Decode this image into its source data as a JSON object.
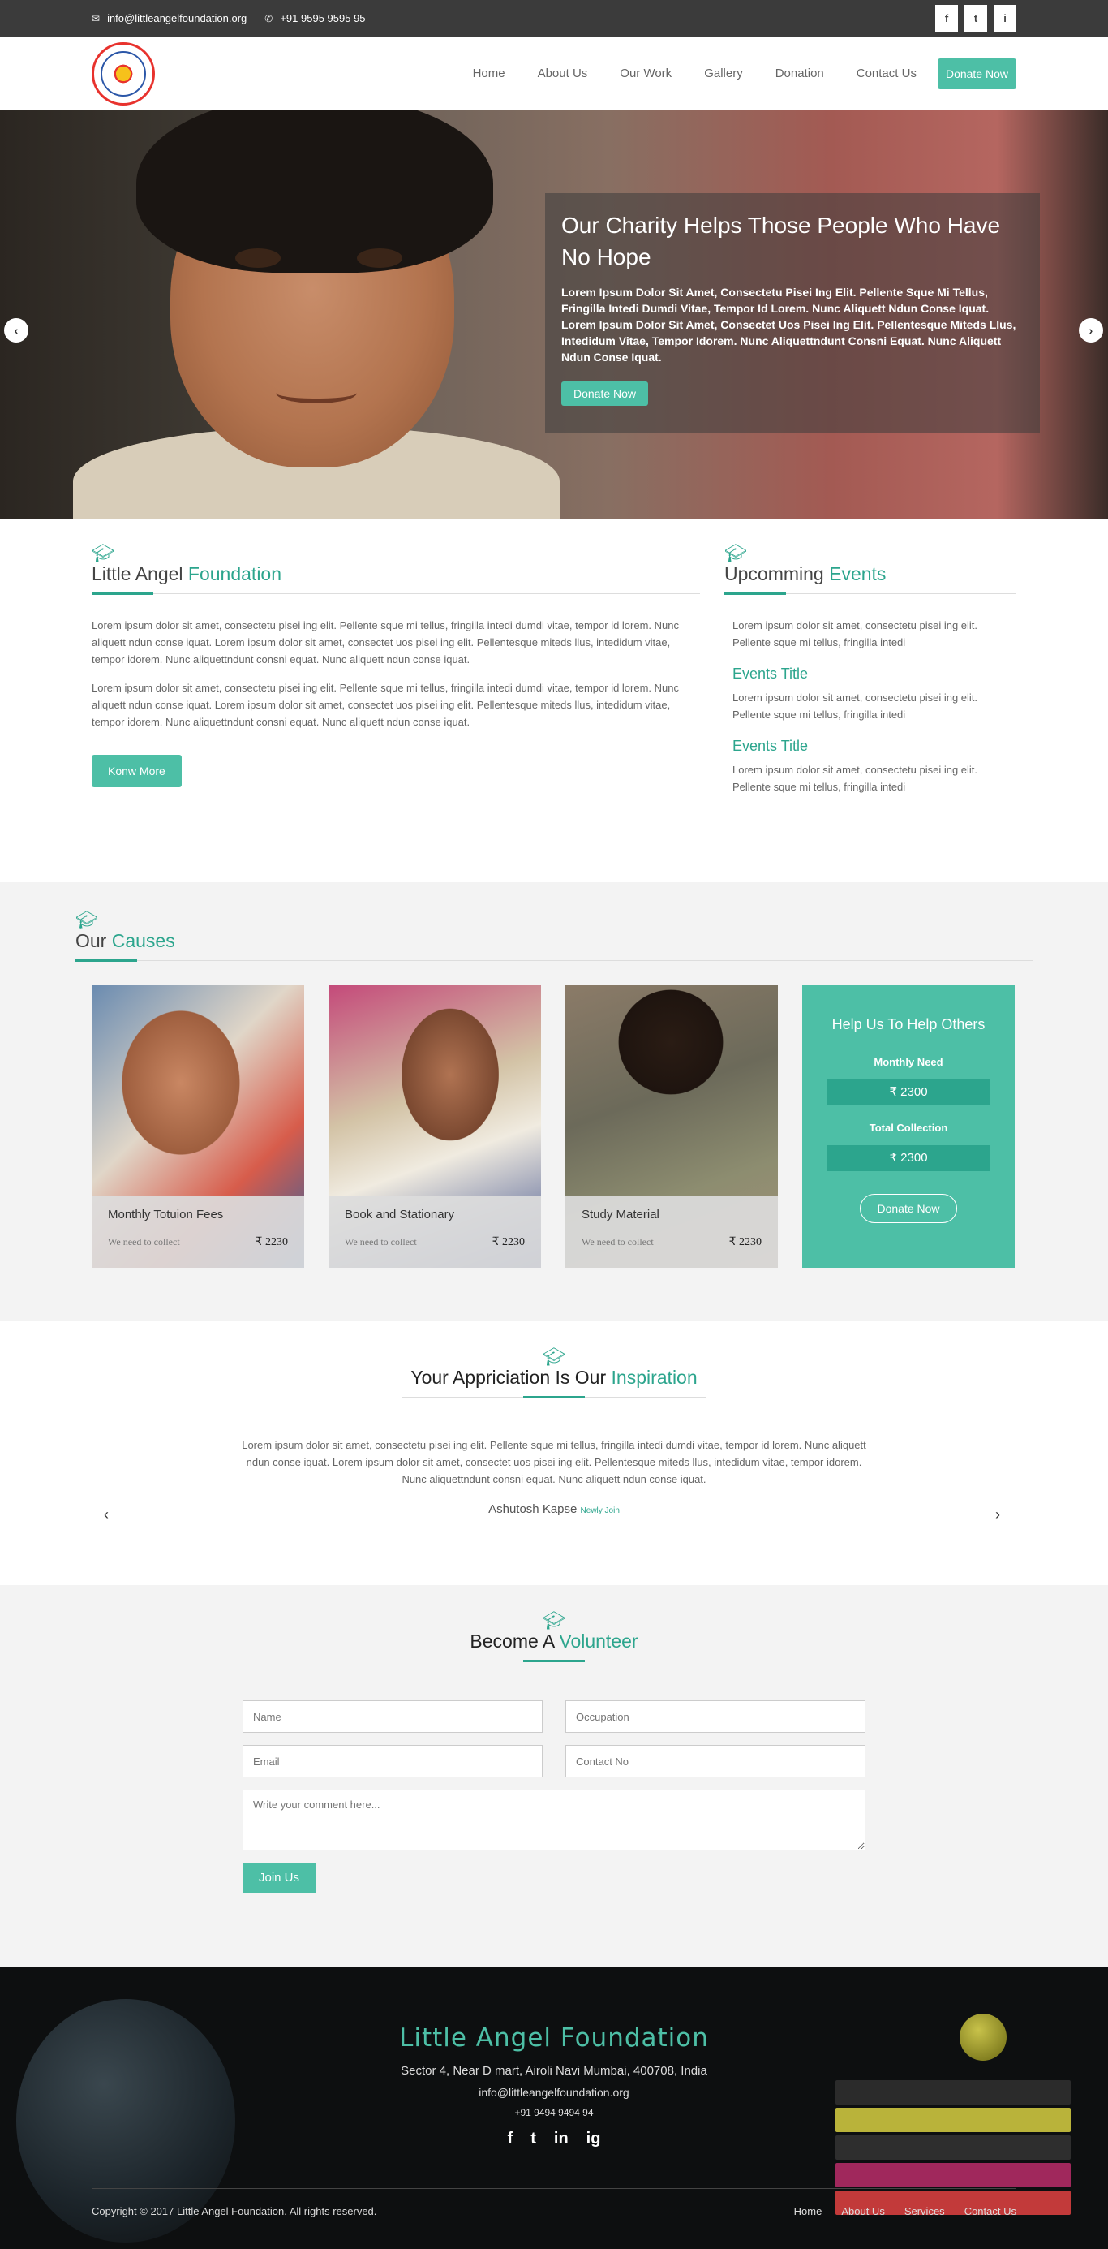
{
  "topbar": {
    "email": "info@littleangelfoundation.org",
    "phone": "+91 9595 9595 95",
    "email_icon": "envelope-icon",
    "phone_icon": "phone-icon",
    "socials": [
      "f",
      "t",
      "i"
    ]
  },
  "nav": {
    "logo": "Little Angel Foundation logo",
    "items": [
      "Home",
      "About Us",
      "Our Work",
      "Gallery",
      "Donation",
      "Contact Us"
    ],
    "cta": "Donate Now"
  },
  "hero": {
    "title": "Our Charity Helps Those People Who Have No Hope",
    "text": "Lorem Ipsum Dolor Sit Amet, Consectetu Pisei Ing Elit. Pellente Sque Mi Tellus, Fringilla Intedi Dumdi Vitae, Tempor Id Lorem. Nunc Aliquett Ndun Conse Iquat. Lorem Ipsum Dolor Sit Amet, Consectet Uos Pisei Ing Elit. Pellentesque Miteds Llus, Intedidum Vitae, Tempor Idorem. Nunc Aliquettndunt Consni Equat. Nunc Aliquett Ndun Conse Iquat.",
    "button": "Donate Now",
    "prev": "‹",
    "next": "›"
  },
  "about": {
    "title_plain": "Little Angel",
    "title_hl": "Foundation",
    "para1": "Lorem ipsum dolor sit amet, consectetu pisei ing elit. Pellente sque mi tellus, fringilla intedi dumdi vitae, tempor id lorem. Nunc aliquett ndun conse iquat. Lorem ipsum dolor sit amet, consectet uos pisei ing elit. Pellentesque miteds llus, intedidum vitae, tempor idorem. Nunc aliquettndunt consni equat. Nunc aliquett ndun conse iquat.",
    "para2": "Lorem ipsum dolor sit amet, consectetu pisei ing elit. Pellente sque mi tellus, fringilla intedi dumdi vitae, tempor id lorem. Nunc aliquett ndun conse iquat. Lorem ipsum dolor sit amet, consectet uos pisei ing elit. Pellentesque miteds llus, intedidum vitae, tempor idorem. Nunc aliquettndunt consni equat. Nunc aliquett ndun conse iquat.",
    "button": "Konw More"
  },
  "events": {
    "title_plain": "Upcomming",
    "title_hl": "Events",
    "intro": "Lorem ipsum dolor sit amet, consectetu pisei ing elit. Pellente sque mi tellus, fringilla intedi",
    "items": [
      {
        "title": "Events Title",
        "text": "Lorem ipsum dolor sit amet, consectetu pisei ing elit. Pellente sque mi tellus, fringilla intedi"
      },
      {
        "title": "Events Title",
        "text": "Lorem ipsum dolor sit amet, consectetu pisei ing elit. Pellente sque mi tellus, fringilla intedi"
      }
    ]
  },
  "causes": {
    "title_plain": "Our",
    "title_hl": "Causes",
    "cards": [
      {
        "title": "Monthly Totuion Fees",
        "need": "We need to collect",
        "amount": "₹ 2230"
      },
      {
        "title": "Book and Stationary",
        "need": "We need to collect",
        "amount": "₹ 2230"
      },
      {
        "title": "Study Material",
        "need": "We need to collect",
        "amount": "₹ 2230"
      }
    ],
    "help": {
      "title": "Help Us To Help Others",
      "monthly_label": "Monthly Need",
      "monthly_value": "₹ 2300",
      "total_label": "Total Collection",
      "total_value": "₹ 2300",
      "button": "Donate Now"
    }
  },
  "testimonial": {
    "title_plain": "Your Appriciation Is Our",
    "title_hl": "Inspiration",
    "quote": "Lorem ipsum dolor sit amet, consectetu pisei ing elit. Pellente sque mi tellus, fringilla intedi dumdi vitae, tempor id lorem. Nunc aliquett ndun conse iquat. Lorem ipsum dolor sit amet, consectet uos pisei ing elit. Pellentesque miteds llus, intedidum vitae, tempor idorem. Nunc aliquettndunt consni equat. Nunc aliquett ndun conse iquat.",
    "author": "Ashutosh Kapse",
    "tag": "Newly Join",
    "prev": "‹",
    "next": "›"
  },
  "volunteer": {
    "title_plain": "Become A",
    "title_hl": "Volunteer",
    "name_ph": "Name",
    "occupation_ph": "Occupation",
    "email_ph": "Email",
    "contact_ph": "Contact No",
    "comment_ph": "Write your comment here...",
    "button": "Join Us"
  },
  "footer": {
    "name": "Little Angel Foundation",
    "address": "Sector 4, Near D mart, Airoli Navi Mumbai, 400708, India",
    "email": "info@littleangelfoundation.org",
    "phone": "+91 9494 9494 94",
    "socials": [
      "f",
      "t",
      "in",
      "ig"
    ],
    "copyright": "Copyright © 2017 Little Angel Foundation. All rights reserved.",
    "links": [
      "Home",
      "About Us",
      "Services",
      "Contact Us"
    ]
  },
  "colors": {
    "accent": "#4dbfa6",
    "accent_dark": "#2ca58d",
    "topbar": "#3b3b3b",
    "footer": "#0d0f10"
  }
}
